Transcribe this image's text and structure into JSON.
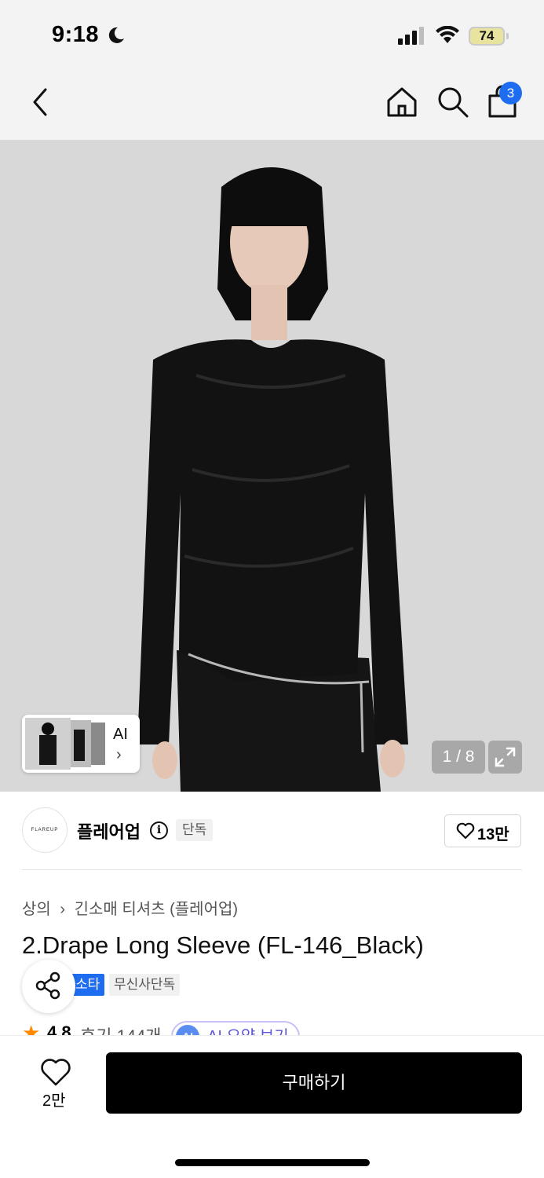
{
  "status_bar": {
    "time": "9:18",
    "battery": "74"
  },
  "nav": {
    "cart_count": "3"
  },
  "gallery": {
    "ai_label": "AI",
    "counter": "1 / 8"
  },
  "brand": {
    "logo_text": "FLAREUP",
    "name": "플레어업",
    "tag": "단독",
    "likes": "13만"
  },
  "breadcrumb": {
    "category": "상의",
    "sub": "긴소매 티셔츠 (플레어업)"
  },
  "product": {
    "title": "2.Drape Long Sleeve (FL-146_Black)",
    "badge_blue": "소타",
    "badge_gray": "무신사단독"
  },
  "rating": {
    "value": "4.8",
    "count": "후기 144개",
    "ai_summary": "AI 요약 보기",
    "ai_badge": "AI"
  },
  "bottom": {
    "wish_count": "2만",
    "buy_label": "구매하기"
  },
  "colors": {
    "accent_blue": "#1e6df0",
    "rating_orange": "#ff8a00"
  }
}
